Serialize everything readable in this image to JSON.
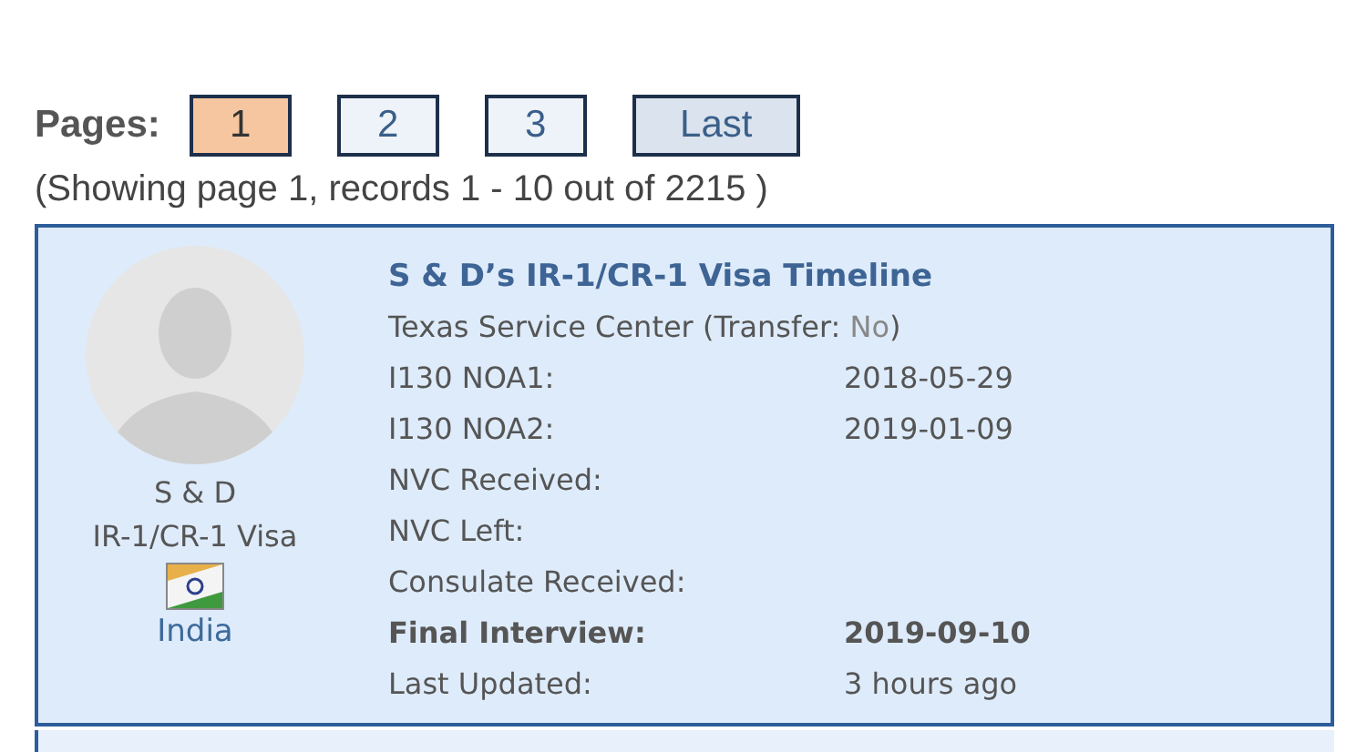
{
  "pagination": {
    "label": "Pages:",
    "pages": [
      {
        "label": "1",
        "selected": true
      },
      {
        "label": "2",
        "selected": false
      },
      {
        "label": "3",
        "selected": false
      },
      {
        "label": "Last",
        "selected": false,
        "kind": "last"
      }
    ],
    "summary": "(Showing page 1, records 1 - 10 out of 2215 )"
  },
  "timelines": [
    {
      "name": "S & D",
      "visa": "IR-1/CR-1 Visa",
      "country": "India",
      "title": "S & D’s IR-1/CR-1 Visa Timeline",
      "service_line": [
        "Texas Service Center (Transfer: ",
        "No",
        ")"
      ],
      "rows": [
        {
          "label": "I130 NOA1:",
          "value": "2018-05-29",
          "kind": "normal"
        },
        {
          "label": "I130 NOA2:",
          "value": "2019-01-09",
          "kind": "normal"
        },
        {
          "label": "NVC Received:",
          "kind": "normal"
        },
        {
          "label": "NVC Left:",
          "kind": "normal"
        },
        {
          "label": "Consulate Received:",
          "kind": "normal"
        },
        {
          "label": "Final Interview:",
          "value": "2019-09-10",
          "kind": "highlight"
        },
        {
          "label": "Last Updated:",
          "value": "3 hours ago",
          "kind": "normal"
        }
      ]
    }
  ]
}
